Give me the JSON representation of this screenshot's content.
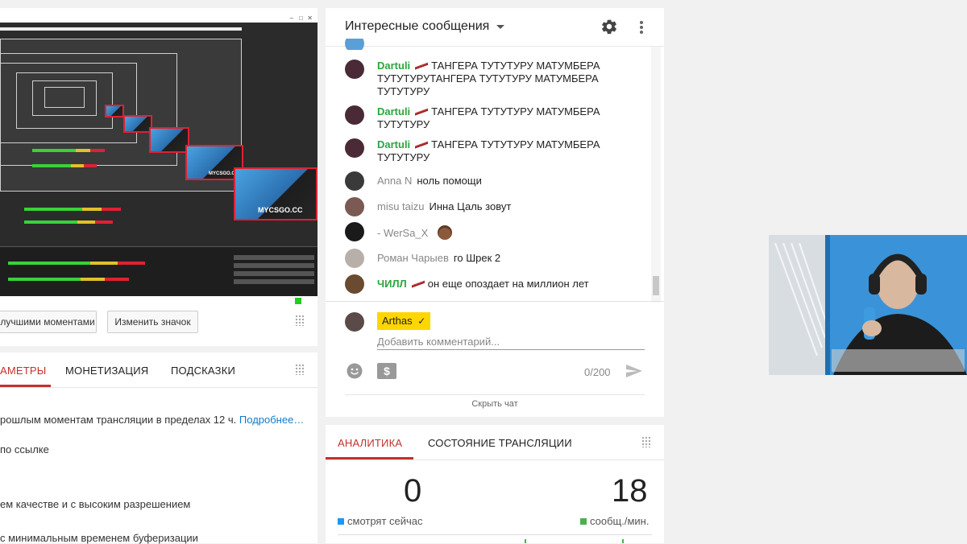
{
  "left": {
    "buttons": {
      "best_moments": "лучшими моментами",
      "change_icon": "Изменить значок"
    },
    "tabs": [
      {
        "label": "АМЕТРЫ",
        "active": true
      },
      {
        "label": "МОНЕТИЗАЦИЯ",
        "active": false
      },
      {
        "label": "ПОДСКАЗКИ",
        "active": false
      }
    ],
    "lines": {
      "l1_text": "рошлым моментам трансляции в пределах 12 ч.",
      "l1_link": "Подробнее…",
      "l2": "по ссылке",
      "l3": "ем качестве и с высоким разрешением",
      "l4": "с минимальным временем буферизации"
    },
    "preview": {
      "logo_text_small": "MYCSGO.CC",
      "logo_text_large": "MYCSGO.CC"
    }
  },
  "chat": {
    "title": "Интересные сообщения",
    "messages": [
      {
        "author": "Dartuli",
        "member": true,
        "badge": "knife",
        "text": "ТАНГЕРА ТУТУТУРУ МАТУМБЕРА ТУТУТУРУТАНГЕРА ТУТУТУРУ МАТУМБЕРА ТУТУТУРУ",
        "avatar_color": "#4a2a36"
      },
      {
        "author": "Dartuli",
        "member": true,
        "badge": "knife",
        "text": "ТАНГЕРА ТУТУТУРУ МАТУМБЕРА ТУТУТУРУ",
        "avatar_color": "#4a2a36"
      },
      {
        "author": "Dartuli",
        "member": true,
        "badge": "knife",
        "text": "ТАНГЕРА ТУТУТУРУ МАТУМБЕРА ТУТУТУРУ",
        "avatar_color": "#4a2a36"
      },
      {
        "author": "Anna N",
        "member": false,
        "badge": "",
        "text": "ноль помощи",
        "avatar_color": "#3a3a3a"
      },
      {
        "author": "misu taizu",
        "member": false,
        "badge": "",
        "text": "Инна Цаль зовут",
        "avatar_color": "#7a5a52"
      },
      {
        "author": "- WerSa_X",
        "member": false,
        "badge": "",
        "text": "",
        "emoji": "man-face",
        "avatar_color": "#1a1a1a"
      },
      {
        "author": "Роман Чарыев",
        "member": false,
        "badge": "",
        "text": "го Шрек 2",
        "avatar_color": "#b8b0a8"
      },
      {
        "author": "ЧИЛЛ",
        "member": true,
        "badge": "knife",
        "text": "он еще опоздает на миллион лет",
        "avatar_color": "#6a4a30"
      }
    ],
    "composer": {
      "user": "Arthas",
      "placeholder": "Добавить комментарий...",
      "counter": "0/200"
    },
    "hide_chat": "Скрыть чат"
  },
  "analytics": {
    "tabs": [
      {
        "label": "АНАЛИТИКА",
        "active": true
      },
      {
        "label": "СОСТОЯНИЕ ТРАНСЛЯЦИИ",
        "active": false
      }
    ],
    "viewers_now": "0",
    "viewers_label": "смотрят сейчас",
    "viewers_color": "#2196f3",
    "msgs_per_min": "18",
    "msgs_label": "сообщ./мин.",
    "msgs_color": "#4caf50"
  },
  "colors": {
    "accent_red": "#c4302b",
    "member_green": "#2ba640",
    "link_blue": "#167ac6"
  }
}
